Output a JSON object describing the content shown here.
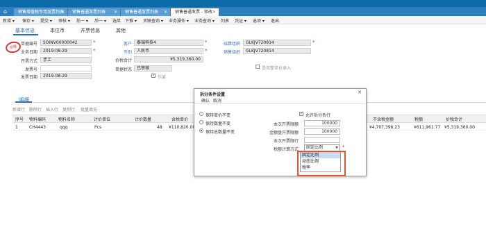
{
  "top_tabs": [
    {
      "label": "销售增值税专用发票列表"
    },
    {
      "label": "销售普通发票列表"
    },
    {
      "label": "销售普通发票列表"
    },
    {
      "label": "销售普通发票 - 修改"
    }
  ],
  "menu": [
    "新增 ▾",
    "保存 ▾",
    "提交 ▾",
    "审核 ▾",
    "前一 ▾",
    "后一 ▾",
    "选单",
    "下推 ▾",
    "关联查询 ▾",
    "业务操作 ▾",
    "业务查询 ▾",
    "列表",
    "凭证 ▾",
    "选项 ▾",
    "退出"
  ],
  "subtabs": [
    "基本信息",
    "本位币",
    "开票信息",
    "其他"
  ],
  "form": {
    "stamp": "创建",
    "doc_no_label": "单据编号",
    "doc_no": "SOINV00000042",
    "date_label": "业务日期",
    "date": "2019-08-29",
    "invoice_type_label": "开票方式",
    "invoice_type": "手工",
    "invoice_no_label": "发票号",
    "invoice_no": "",
    "invoice_date_label": "发票日期",
    "invoice_date": "2019-08-29",
    "customer_label": "客户",
    "customer": "泰瑞科技4",
    "currency_label": "币别",
    "currency": "人民币",
    "amount_label": "价税合计",
    "amount": "¥5,319,360.00",
    "status_label": "单据状态",
    "status": "已审核",
    "invalid_label": "作废",
    "settle_org_label": "结算组织",
    "settle_org": "GLKJV720814",
    "sales_org_label": "销售组织",
    "sales_org": "GLKJV720814",
    "reverse_label": "是否整单价录入"
  },
  "detail": {
    "tab": "明细",
    "tools": [
      "新增行",
      "删除行",
      "插入行",
      "复制行",
      "批量填充"
    ],
    "columns": [
      "序号",
      "物料编码",
      "物料名称",
      "计价单位",
      "计价数量",
      "含税单价",
      "不含税金额",
      "税额",
      "价税合计"
    ],
    "row": {
      "index": "1",
      "code": "CH4443",
      "name": "qqq",
      "unit": "Pcs",
      "qty": "48",
      "price": "¥110,820.00",
      "net": "¥4,707,398.23",
      "tax": "¥611,961.77",
      "total": "¥5,319,360.00"
    }
  },
  "dialog": {
    "title": "拆分条件设置",
    "close": "✕",
    "buttons": [
      "确认",
      "取消"
    ],
    "radios": [
      {
        "label": "保持单价不变",
        "selected": false
      },
      {
        "label": "保持数量不变",
        "selected": false
      },
      {
        "label": "保持总数量不变",
        "selected": true
      }
    ],
    "allow_split_label": "允许拆分负行",
    "fields": [
      {
        "label": "本次开票限额",
        "value": "100000"
      },
      {
        "label": "金额盘开票限额",
        "value": "100000"
      },
      {
        "label": "本次开票限行",
        "value": ""
      }
    ],
    "tax_method_label": "税额计算方式",
    "tax_method_value": "固定比例",
    "options": [
      "固定比例",
      "动态比例",
      "税率"
    ]
  }
}
